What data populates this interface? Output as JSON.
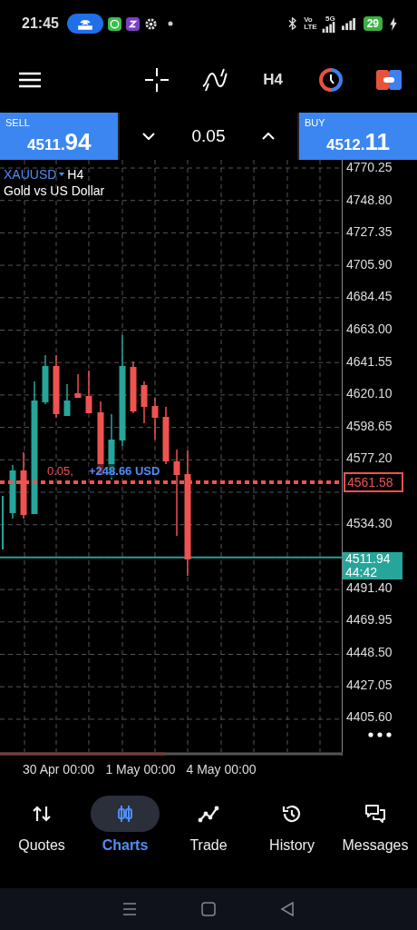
{
  "status_bar": {
    "time": "21:45",
    "network_labels": [
      "Vo",
      "LTE",
      "5G"
    ],
    "battery": "29"
  },
  "toolbar": {
    "timeframe": "H4"
  },
  "trade_panel": {
    "sell": {
      "label": "SELL",
      "price_small": "4511.",
      "price_big": "94"
    },
    "lot": "0.05",
    "buy": {
      "label": "BUY",
      "price_small": "4512.",
      "price_big": "11"
    }
  },
  "chart": {
    "symbol": "XAUUSD",
    "timeframe": "H4",
    "description": "Gold vs US Dollar",
    "price_axis": [
      "4770.25",
      "4748.80",
      "4727.35",
      "4705.90",
      "4684.45",
      "4663.00",
      "4641.55",
      "4620.10",
      "4598.65",
      "4577.20",
      "4534.30",
      "4491.40",
      "4469.95",
      "4448.50",
      "4427.05",
      "4405.60"
    ],
    "position_line": {
      "volume": "0.05,",
      "profit": "+248.66 USD",
      "price": "4561.58"
    },
    "bid_line": {
      "price": "4511.94",
      "countdown": "44:42"
    },
    "time_axis": [
      "30 Apr 00:00",
      "1 May 00:00",
      "4 May 00:00"
    ]
  },
  "nav": [
    {
      "label": "Quotes",
      "selected": false
    },
    {
      "label": "Charts",
      "selected": true
    },
    {
      "label": "Trade",
      "selected": false
    },
    {
      "label": "History",
      "selected": false
    },
    {
      "label": "Messages",
      "selected": false
    }
  ]
}
